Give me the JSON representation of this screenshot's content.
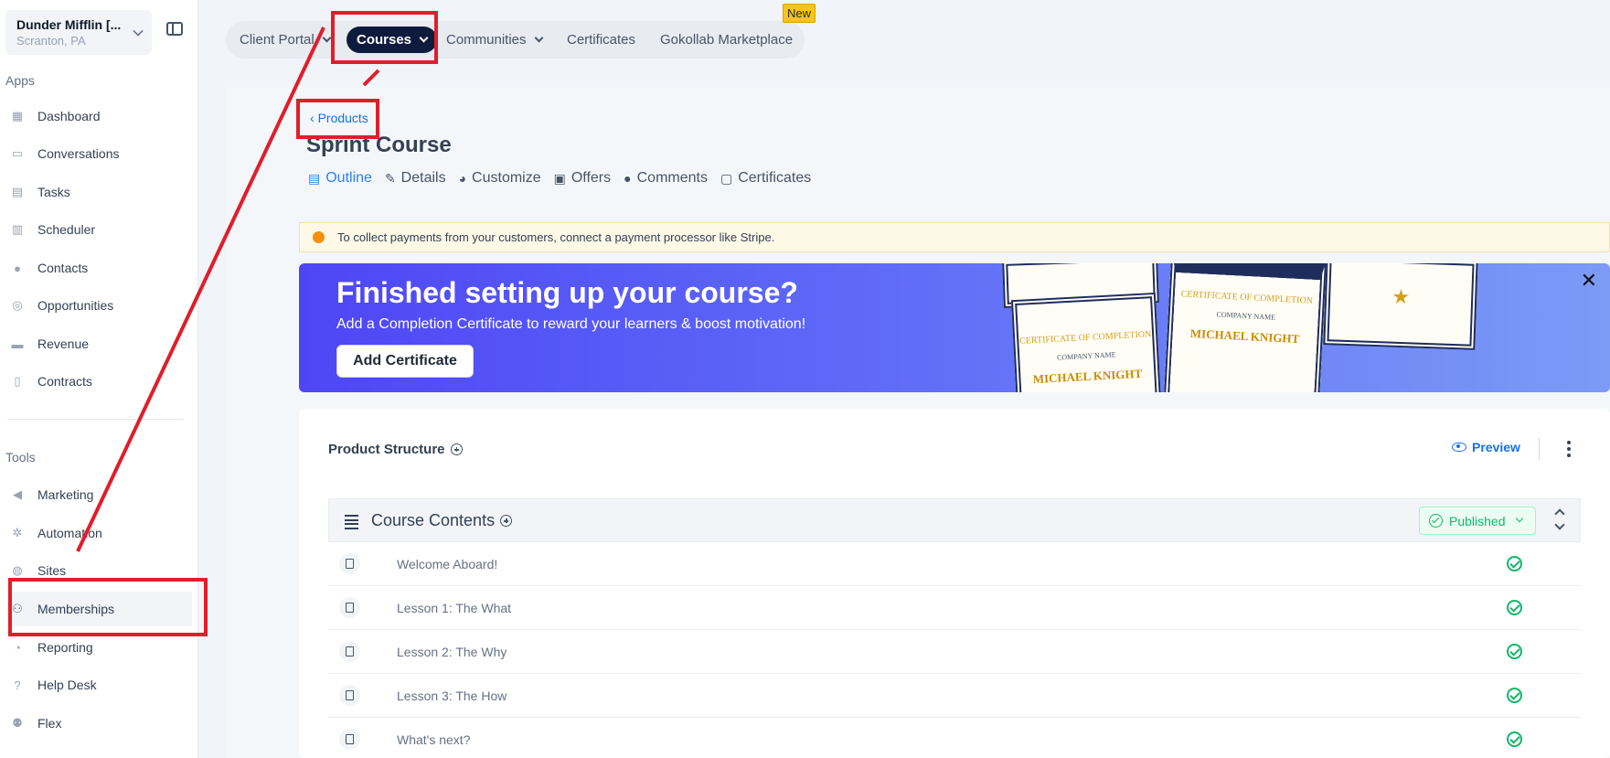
{
  "account": {
    "name": "Dunder Mifflin [...",
    "location": "Scranton, PA"
  },
  "sidebar": {
    "apps_label": "Apps",
    "tools_label": "Tools",
    "apps": [
      {
        "label": "Dashboard",
        "icon": "dashboard-icon"
      },
      {
        "label": "Conversations",
        "icon": "chat-icon"
      },
      {
        "label": "Tasks",
        "icon": "tasks-icon"
      },
      {
        "label": "Scheduler",
        "icon": "calendar-icon"
      },
      {
        "label": "Contacts",
        "icon": "person-icon"
      },
      {
        "label": "Opportunities",
        "icon": "target-icon"
      },
      {
        "label": "Revenue",
        "icon": "card-icon"
      },
      {
        "label": "Contracts",
        "icon": "document-icon"
      }
    ],
    "tools": [
      {
        "label": "Marketing",
        "icon": "megaphone-icon"
      },
      {
        "label": "Automation",
        "icon": "gears-icon"
      },
      {
        "label": "Sites",
        "icon": "globe-icon"
      },
      {
        "label": "Memberships",
        "icon": "members-icon"
      },
      {
        "label": "Reporting",
        "icon": "pie-icon"
      },
      {
        "label": "Help Desk",
        "icon": "help-icon"
      },
      {
        "label": "Flex",
        "icon": "people-icon"
      }
    ]
  },
  "topnav": {
    "tabs": [
      "Client Portal",
      "Courses",
      "Communities",
      "Certificates",
      "Gokollab Marketplace"
    ],
    "new_badge": "New"
  },
  "page": {
    "back_link": "Products",
    "title": "Sprint Course",
    "subtabs": [
      "Outline",
      "Details",
      "Customize",
      "Offers",
      "Comments",
      "Certificates"
    ]
  },
  "alert": {
    "text": "To collect payments from your customers, connect a payment processor like Stripe."
  },
  "banner": {
    "heading": "Finished setting up your course?",
    "subtext": "Add a Completion Certificate to reward your learners & boost motivation!",
    "button": "Add Certificate",
    "cert_title": "CERTIFICATE OF COMPLETION",
    "cert_company": "COMPANY NAME",
    "cert_name": "MICHAEL KNIGHT"
  },
  "structure": {
    "title": "Product Structure",
    "preview": "Preview",
    "contents_title": "Course Contents",
    "status": "Published",
    "lessons": [
      "Welcome Aboard!",
      "Lesson 1: The What",
      "Lesson 2: The Why",
      "Lesson 3: The How",
      "What's next?"
    ]
  },
  "colors": {
    "accent": "#1570ef",
    "nav_active": "#0f1b3d",
    "success": "#12b76a",
    "annotation": "#e11d2a",
    "badge": "#fcc419"
  }
}
